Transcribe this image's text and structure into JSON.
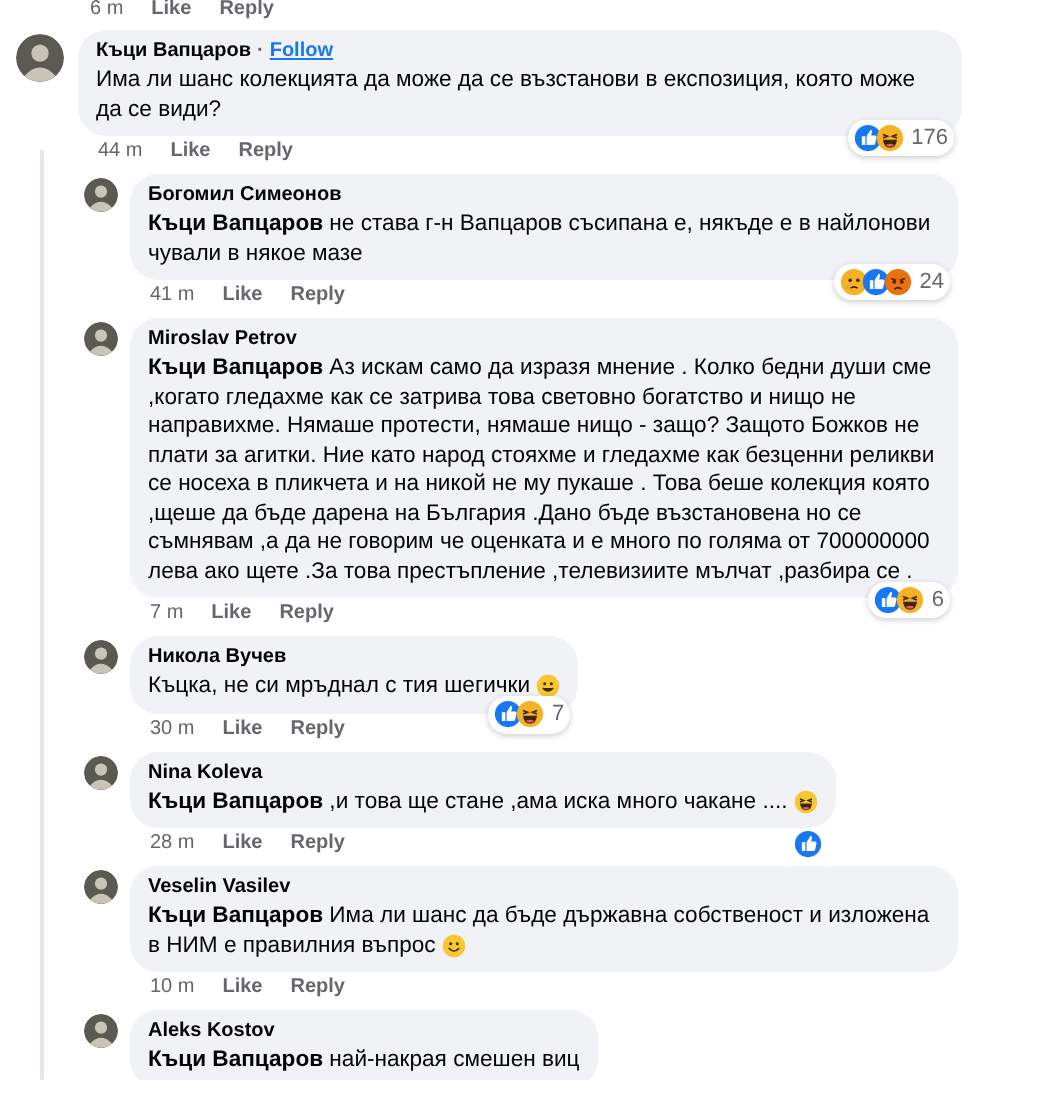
{
  "previous_actions": {
    "time": "6 m",
    "like": "Like",
    "reply": "Reply"
  },
  "comment": {
    "author": "Къци Вапцаров",
    "separator": "·",
    "follow": "Follow",
    "text": "Има ли шанс колекцията да може да се възстанови в експозиция, която може да се види?",
    "time": "44 m",
    "like": "Like",
    "reply": "Reply",
    "reactions": [
      {
        "kind": "like"
      },
      {
        "kind": "haha"
      }
    ],
    "reaction_count": "176",
    "replies": [
      {
        "author": "Богомил Симеонов",
        "text": "**Къци Вапцаров** не става г-н Вапцаров съсипана е, някъде е в найлонови чували в някое мазе",
        "time": "41 m",
        "like": "Like",
        "reply": "Reply",
        "reactions": [
          {
            "kind": "sad"
          },
          {
            "kind": "like"
          },
          {
            "kind": "angry"
          }
        ],
        "reaction_count": "24"
      },
      {
        "author": "Miroslav Petrov",
        "text": "**Къци Вапцаров** Аз искам само да изразя мнение . Колко бедни души сме ,когато гледахме как се затрива това световно богатство и нищо не направихме. Нямаше протести, нямаше нищо - защо? Защото Божков не плати за агитки. Ние като народ стояхме и гледахме как безценни реликви се носеха в пликчета и на никой не му пукаше . Това беше колекция която ,щеше да бъде дарена на България .Дано бъде възстановена но се съмнявам ,а да не говорим че оценката и е много по голяма от 700000000 лева ако щете .За това престъпление ,телевизиите мълчат ,разбира се .",
        "time": "7 m",
        "like": "Like",
        "reply": "Reply",
        "reactions": [
          {
            "kind": "like"
          },
          {
            "kind": "haha"
          }
        ],
        "reaction_count": "6"
      },
      {
        "author": "Никола Вучев",
        "text": "Къцка, не си мръднал с тия шегички",
        "emoji": {
          "kind": "grin"
        },
        "time": "30 m",
        "like": "Like",
        "reply": "Reply",
        "reactions": [
          {
            "kind": "like"
          },
          {
            "kind": "haha"
          }
        ],
        "reaction_count": "7"
      },
      {
        "author": "Nina Koleva",
        "text": "**Къци Вапцаров** ,и това ще стане ,ама иска много чакане ....",
        "emoji": {
          "kind": "laugh"
        },
        "time": "28 m",
        "like": "Like",
        "reply": "Reply",
        "reactions": [
          {
            "kind": "like"
          }
        ]
      },
      {
        "author": "Veselin Vasilev",
        "text": "**Къци Вапцаров** Има ли шанс да бъде държавна собственост и изложена в НИМ е правилния въпрос",
        "emoji": {
          "kind": "smile"
        },
        "time": "10 m",
        "like": "Like",
        "reply": "Reply"
      },
      {
        "author": "Aleks Kostov",
        "text": "**Къци Вапцаров** най-накрая смешен виц"
      }
    ]
  }
}
